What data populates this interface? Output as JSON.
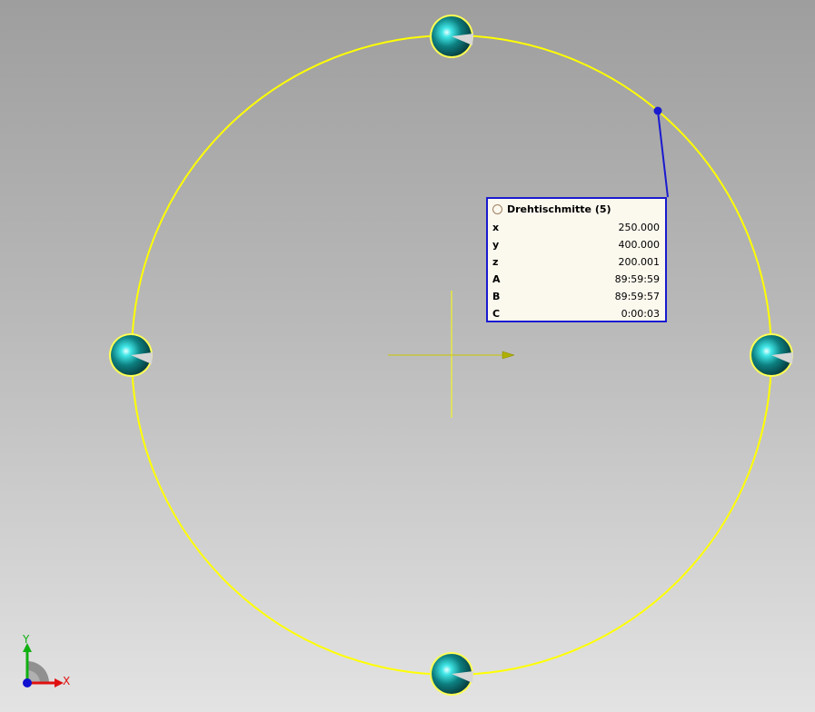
{
  "viewport": {
    "background_top": "#9e9e9e",
    "background_bottom": "#e3e3e3"
  },
  "scene": {
    "circle_color": "#ffff00",
    "sphere_color": "#0d7f80",
    "pointer_color": "#1a1ad0",
    "axis_glyph_color": "#c8c800",
    "spheres": [
      {
        "name": "top"
      },
      {
        "name": "left"
      },
      {
        "name": "right"
      },
      {
        "name": "bottom"
      }
    ]
  },
  "info_panel": {
    "icon": "circle-icon",
    "title": "Drehtischmitte (5)",
    "rows": [
      {
        "label": "x",
        "value": "250.000"
      },
      {
        "label": "y",
        "value": "400.000"
      },
      {
        "label": "z",
        "value": "200.001"
      },
      {
        "label": "A",
        "value": "89:59:59"
      },
      {
        "label": "B",
        "value": "89:59:57"
      },
      {
        "label": "C",
        "value": "0:00:03"
      }
    ]
  },
  "axis_indicator": {
    "x_label": "X",
    "y_label": "Y",
    "x_color": "#e01010",
    "y_color": "#10b010",
    "origin_color": "#1010d0"
  }
}
